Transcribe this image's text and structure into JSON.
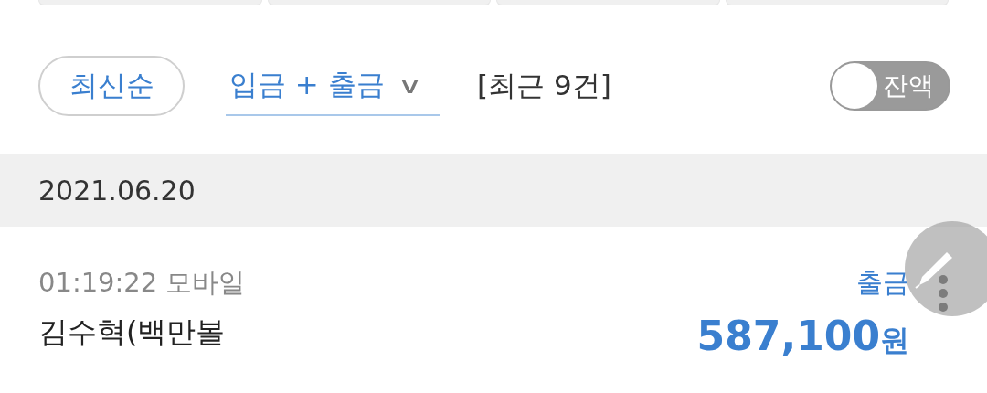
{
  "top_tabs": [
    {
      "kind": "tab"
    },
    {
      "kind": "tab"
    },
    {
      "kind": "tab"
    },
    {
      "kind": "tab"
    }
  ],
  "sort_button": {
    "label": "최신순"
  },
  "filter_dropdown": {
    "label": "입금 + 출금",
    "caret": "∨"
  },
  "count": "[최근 9건]",
  "balance_toggle": {
    "label": "잔액",
    "on": false
  },
  "groups": [
    {
      "date": "2021.06.20",
      "transactions": [
        {
          "time": "01:19:22 모바일",
          "name": "김수혁(백만볼",
          "type": "출금",
          "amount": "587,100",
          "currency": "원"
        }
      ]
    }
  ]
}
